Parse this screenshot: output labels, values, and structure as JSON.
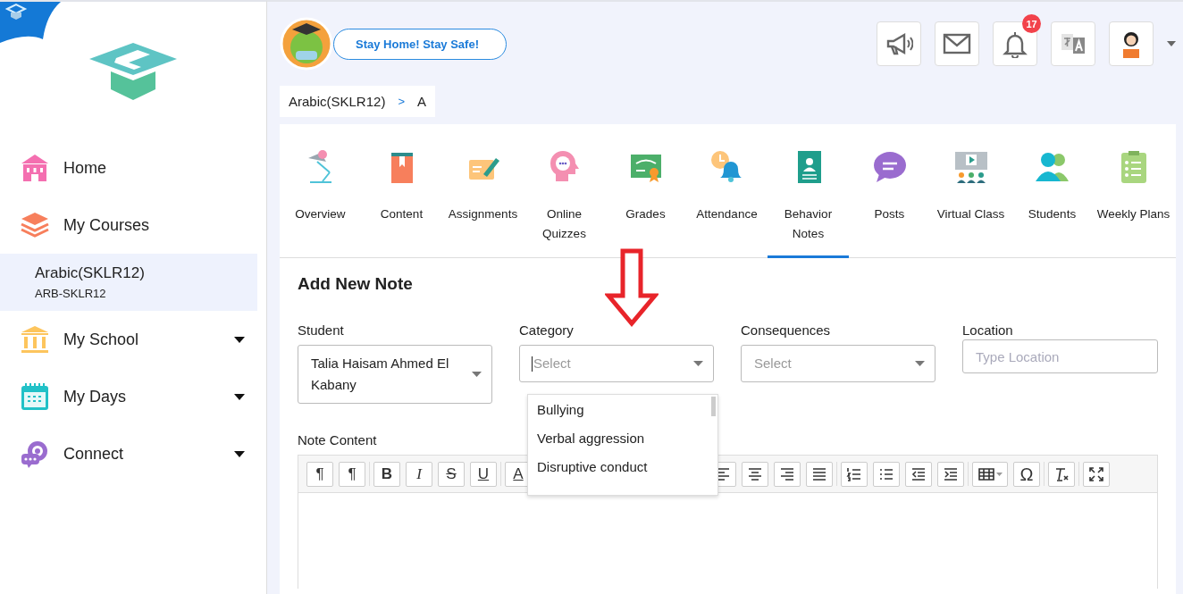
{
  "sidebar": {
    "items": [
      {
        "kind": "home",
        "label": "Home",
        "selected": false,
        "expandable": false
      },
      {
        "kind": "courses",
        "label": "My Courses",
        "selected": false,
        "expandable": false
      },
      {
        "kind": "course",
        "label": "Arabic(SKLR12)",
        "code": "ARB-SKLR12",
        "selected": true
      },
      {
        "kind": "school",
        "label": "My School",
        "selected": false,
        "expandable": true
      },
      {
        "kind": "days",
        "label": "My Days",
        "selected": false,
        "expandable": true
      },
      {
        "kind": "connect",
        "label": "Connect",
        "selected": false,
        "expandable": true
      }
    ]
  },
  "header": {
    "banner": "Stay Home! Stay Safe!",
    "actions": [
      {
        "kind": "megaphone"
      },
      {
        "kind": "mail"
      },
      {
        "kind": "bell",
        "badge": "17"
      },
      {
        "kind": "translate"
      },
      {
        "kind": "profile"
      }
    ]
  },
  "breadcrumb": {
    "items": [
      "Arabic(SKLR12)",
      "A"
    ],
    "separator": ">"
  },
  "tabs": [
    {
      "kind": "overview",
      "label": "Overview",
      "selected": false
    },
    {
      "kind": "content",
      "label": "Content",
      "selected": false
    },
    {
      "kind": "assignments",
      "label": "Assignments",
      "selected": false
    },
    {
      "kind": "quizzes",
      "label": "Online Quizzes",
      "selected": false
    },
    {
      "kind": "grades",
      "label": "Grades",
      "selected": false
    },
    {
      "kind": "attendance",
      "label": "Attendance",
      "selected": false
    },
    {
      "kind": "behavior",
      "label": "Behavior Notes",
      "selected": true
    },
    {
      "kind": "posts",
      "label": "Posts",
      "selected": false
    },
    {
      "kind": "virtual",
      "label": "Virtual Class",
      "selected": false
    },
    {
      "kind": "students",
      "label": "Students",
      "selected": false
    },
    {
      "kind": "plans",
      "label": "Weekly Plans",
      "selected": false
    }
  ],
  "annotation": {
    "kind": "down-arrow"
  },
  "form": {
    "title": "Add New Note",
    "fields": [
      {
        "kind": "select",
        "label": "Student",
        "value": "Talia Haisam Ahmed El Kabany",
        "expanded": false
      },
      {
        "kind": "select",
        "label": "Category",
        "placeholder": "Select",
        "expanded": true,
        "options": [
          "Bullying",
          "Verbal aggression",
          "Disruptive conduct"
        ]
      },
      {
        "kind": "select",
        "label": "Consequences",
        "placeholder": "Select",
        "expanded": false
      },
      {
        "kind": "text",
        "label": "Location",
        "placeholder": "Type Location"
      }
    ],
    "editor": {
      "label": "Note Content",
      "toolbar": [
        [
          {
            "kind": "ltr",
            "label": "¶"
          },
          {
            "kind": "rtl",
            "label": "¶"
          }
        ],
        [
          {
            "kind": "bold",
            "label": "B"
          },
          {
            "kind": "italic",
            "label": "I"
          },
          {
            "kind": "strike",
            "label": "S"
          },
          {
            "kind": "underline",
            "label": "U"
          }
        ],
        [
          {
            "kind": "text-color",
            "label": "A"
          }
        ],
        [
          {
            "kind": "align-left"
          },
          {
            "kind": "align-center"
          },
          {
            "kind": "align-right"
          },
          {
            "kind": "justify"
          }
        ],
        [
          {
            "kind": "numbered-list"
          },
          {
            "kind": "bullet-list"
          },
          {
            "kind": "outdent"
          },
          {
            "kind": "indent"
          }
        ],
        [
          {
            "kind": "table"
          },
          {
            "kind": "special-char",
            "label": "Ω"
          }
        ],
        [
          {
            "kind": "clear-format"
          }
        ],
        [
          {
            "kind": "fullscreen"
          }
        ]
      ]
    }
  }
}
